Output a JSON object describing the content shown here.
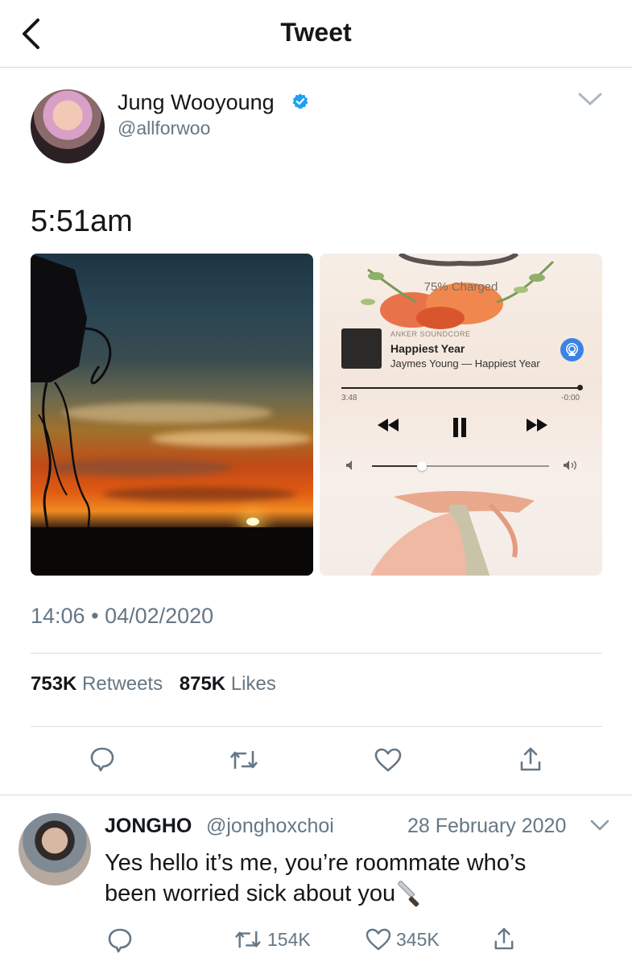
{
  "header": {
    "title": "Tweet",
    "back_icon": "chevron-left-icon"
  },
  "tweet": {
    "author_name": "Jung Wooyoung",
    "author_handle": "@allforwoo",
    "verified": true,
    "text": "5:51am",
    "media": {
      "music_player": {
        "charge_status": "75% Charged",
        "source": "ANKER SOUNDCORE",
        "title": "Happiest Year",
        "artist_album": "Jaymes Young — Happiest Year",
        "elapsed": "3:48",
        "remaining": "-0:00",
        "progress": 1.0,
        "volume_level": 0.28
      }
    },
    "time": "14:06",
    "separator": "•",
    "date": "04/02/2020",
    "retweets_count": "753K",
    "retweets_label": "Retweets",
    "likes_count": "875K",
    "likes_label": "Likes"
  },
  "reply": {
    "author_name": "JONGHO",
    "author_handle": "@jonghoxchoi",
    "date": "28 February 2020",
    "text_line1": "Yes hello it’s me, you’re roommate who’s",
    "text_line2": "been worried sick about you",
    "retweet_count": "154K",
    "like_count": "345K"
  },
  "colors": {
    "text_primary": "#14171a",
    "text_secondary": "#657786",
    "divider": "#d8dde1",
    "verified_blue": "#1da1f2",
    "airplay_blue": "#3b82e6"
  }
}
